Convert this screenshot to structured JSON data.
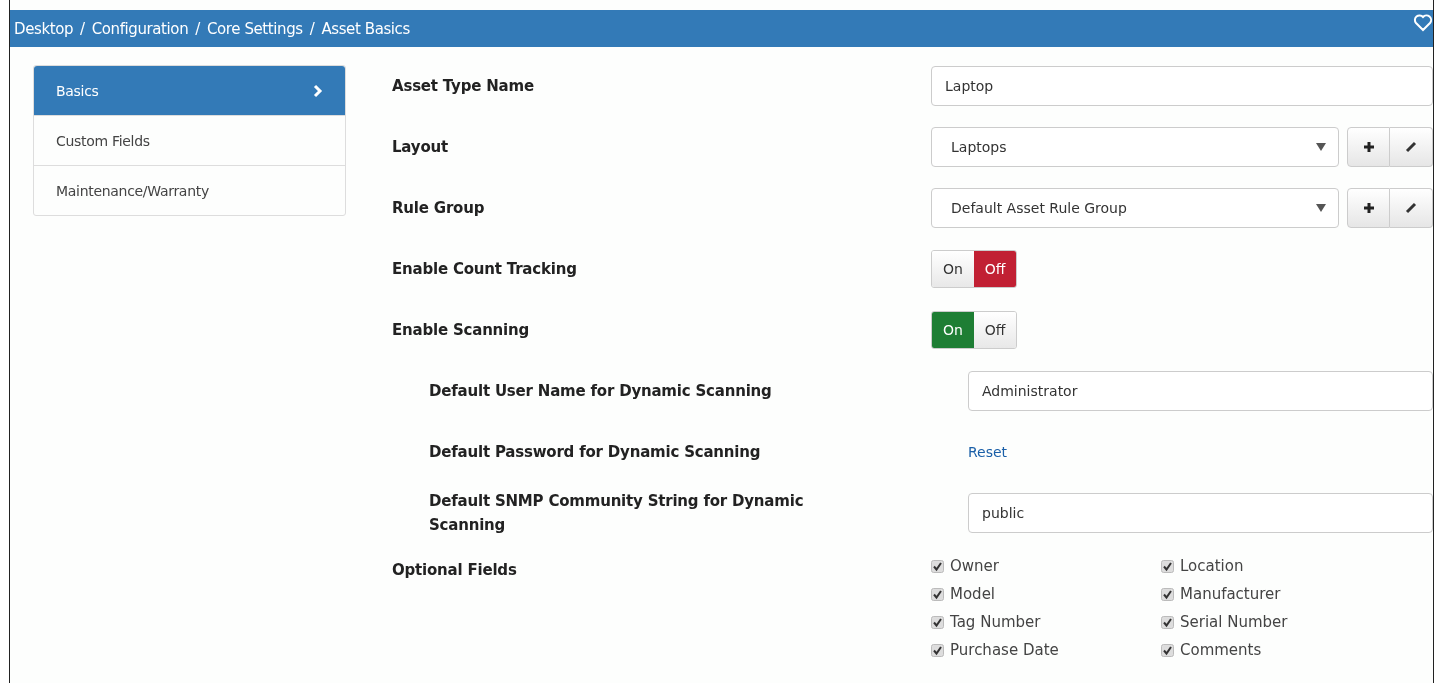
{
  "breadcrumb": {
    "items": [
      "Desktop",
      "Configuration",
      "Core Settings",
      "Asset Basics"
    ],
    "separator": "/"
  },
  "sidebar": {
    "items": [
      {
        "label": "Basics",
        "selected": true
      },
      {
        "label": "Custom Fields",
        "selected": false
      },
      {
        "label": "Maintenance/Warranty",
        "selected": false
      }
    ]
  },
  "form": [
    {
      "kind": "text",
      "label": "Asset Type Name",
      "value": "Laptop"
    },
    {
      "kind": "select",
      "label": "Layout",
      "value": "Laptops"
    },
    {
      "kind": "select",
      "label": "Rule Group",
      "value": "Default Asset Rule Group"
    },
    {
      "kind": "toggle",
      "label": "Enable Count Tracking",
      "on": false,
      "on_label": "On",
      "off_label": "Off"
    },
    {
      "kind": "toggle",
      "label": "Enable Scanning",
      "on": true,
      "on_label": "On",
      "off_label": "Off",
      "children": [
        {
          "kind": "text",
          "label": "Default User Name for Dynamic Scanning",
          "value": "Administrator"
        },
        {
          "kind": "link",
          "label": "Default Password for Dynamic Scanning",
          "value": "Reset"
        },
        {
          "kind": "text",
          "label": "Default SNMP Community String for Dynamic Scanning",
          "value": "public"
        }
      ]
    },
    {
      "kind": "checks",
      "label": "Optional Fields",
      "options": [
        {
          "label": "Owner",
          "checked": true
        },
        {
          "label": "Location",
          "checked": true
        },
        {
          "label": "Model",
          "checked": true
        },
        {
          "label": "Manufacturer",
          "checked": true
        },
        {
          "label": "Tag Number",
          "checked": true
        },
        {
          "label": "Serial Number",
          "checked": true
        },
        {
          "label": "Purchase Date",
          "checked": true
        },
        {
          "label": "Comments",
          "checked": true
        }
      ]
    }
  ]
}
